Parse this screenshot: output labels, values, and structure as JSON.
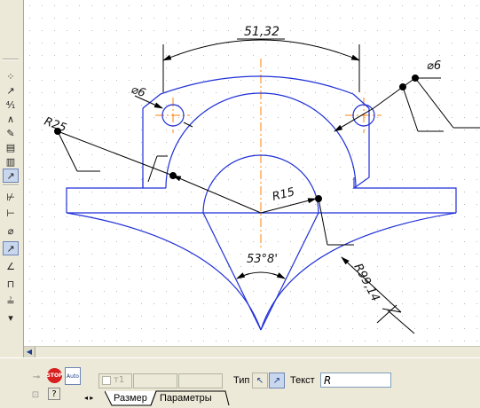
{
  "drawing": {
    "dim_chord": "51,32",
    "dim_diam_left": "⌀6",
    "dim_diam_right": "⌀6",
    "dim_radius_r25": "R25",
    "dim_radius_r15": "R15",
    "dim_angle": "53°8'",
    "dim_radius_r99": "R99,14"
  },
  "bottom_panel": {
    "field_label": "т1",
    "type_label": "Тип",
    "text_label": "Текст",
    "text_value": "R",
    "auto_label": "Auto",
    "stop_label": "STOP"
  },
  "tabs": [
    "Размер",
    "Параметры"
  ],
  "colors": {
    "contour": "#1f2fd8",
    "axis": "#ff8000",
    "dimension": "#000000",
    "grid": "#c8c8c8"
  },
  "left_toolbar": [
    {
      "name": "linear-dim-icon",
      "glyph": "⊢",
      "active": false
    },
    {
      "name": "auto-dim-icon",
      "glyph": "↗",
      "active": false
    },
    {
      "name": "angle-dim-icon",
      "glyph": "∠",
      "active": false
    },
    {
      "name": "diameter-icon",
      "glyph": "⌀",
      "active": false
    },
    {
      "name": "radius-icon",
      "glyph": "↗",
      "active": true
    },
    {
      "name": "arc-dim-icon",
      "glyph": "⌒",
      "active": false
    },
    {
      "name": "height-dim-icon",
      "glyph": "⊤",
      "active": false
    },
    {
      "name": "chain-dim-icon",
      "glyph": "≡",
      "active": false
    }
  ]
}
